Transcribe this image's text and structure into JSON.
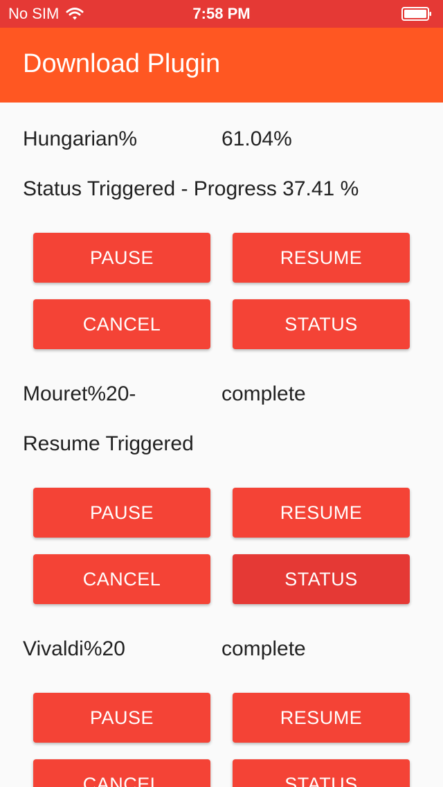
{
  "status_bar": {
    "carrier": "No SIM",
    "time": "7:58 PM",
    "wifi_icon": "wifi-icon",
    "battery_icon": "battery-icon"
  },
  "app_bar": {
    "title": "Download Plugin",
    "background": "#ff5722"
  },
  "accent_button_color": "#f44336",
  "downloads": [
    {
      "name": "Hungarian%",
      "progress": "61.04%",
      "status": "Status Triggered - Progress 37.41 %",
      "buttons": {
        "pause": "PAUSE",
        "resume": "RESUME",
        "cancel": "CANCEL",
        "status": "STATUS"
      }
    },
    {
      "name": "Mouret%20-",
      "progress": "complete",
      "status": "Resume Triggered",
      "buttons": {
        "pause": "PAUSE",
        "resume": "RESUME",
        "cancel": "CANCEL",
        "status": "STATUS"
      }
    },
    {
      "name": "Vivaldi%20",
      "progress": "complete",
      "status": "",
      "buttons": {
        "pause": "PAUSE",
        "resume": "RESUME",
        "cancel": "CANCEL",
        "status": "STATUS"
      }
    }
  ]
}
